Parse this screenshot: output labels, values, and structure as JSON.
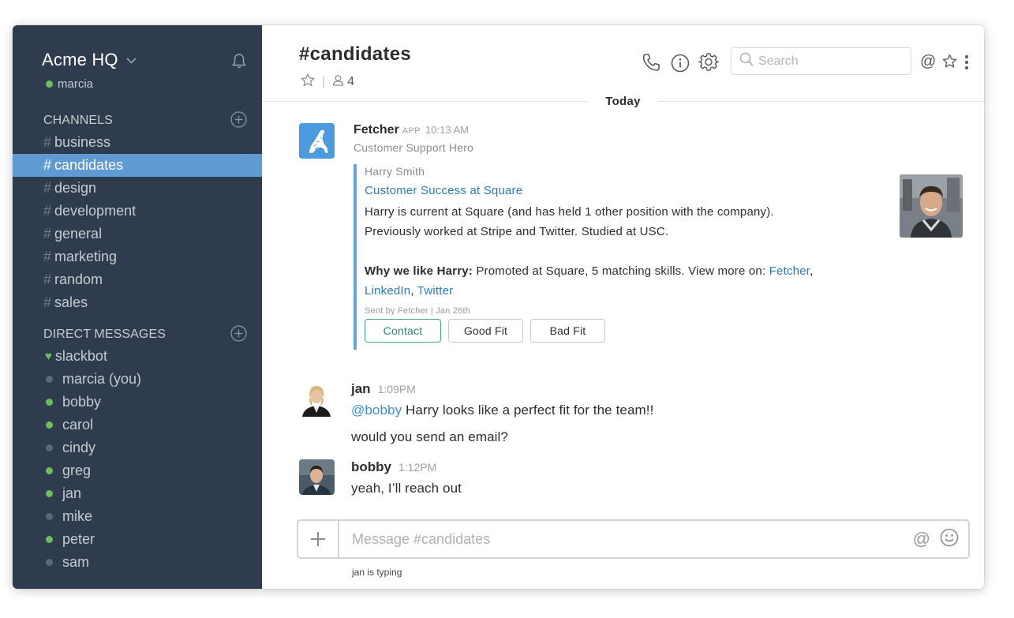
{
  "workspace": {
    "name": "Acme HQ",
    "current_user": "marcia"
  },
  "sidebar": {
    "channels_heading": "CHANNELS",
    "channels": [
      {
        "label": "business",
        "active": false
      },
      {
        "label": "candidates",
        "active": true
      },
      {
        "label": "design",
        "active": false
      },
      {
        "label": "development",
        "active": false
      },
      {
        "label": "general",
        "active": false
      },
      {
        "label": "marketing",
        "active": false
      },
      {
        "label": "random",
        "active": false
      },
      {
        "label": "sales",
        "active": false
      }
    ],
    "dm_heading": "DIRECT MESSAGES",
    "dms": [
      {
        "label": "slackbot",
        "status": "bot"
      },
      {
        "label": "marcia (you)",
        "status": "away"
      },
      {
        "label": "bobby",
        "status": "online"
      },
      {
        "label": "carol",
        "status": "online"
      },
      {
        "label": "cindy",
        "status": "away"
      },
      {
        "label": "greg",
        "status": "online"
      },
      {
        "label": "jan",
        "status": "online"
      },
      {
        "label": "mike",
        "status": "away"
      },
      {
        "label": "peter",
        "status": "online"
      },
      {
        "label": "sam",
        "status": "away"
      }
    ]
  },
  "header": {
    "channel_name": "#candidates",
    "member_count": "4",
    "search_placeholder": "Search"
  },
  "divider": {
    "label": "Today"
  },
  "messages": {
    "fetcher": {
      "author": "Fetcher",
      "badge": "APP",
      "time": "10:13 AM",
      "subtitle": "Customer Support Hero",
      "attachment": {
        "pretext": "Harry Smith",
        "title": "Customer Success at Square",
        "line1": "Harry is current at Square (and has held 1 other position with the company).",
        "line2": "Previously worked at Stripe and Twitter. Studied at USC.",
        "why_label": "Why we like Harry:",
        "why_text": " Promoted at Square, 5 matching skills. View more on: ",
        "link_fetcher": "Fetcher",
        "link_linkedin": "LinkedIn",
        "link_twitter": "Twitter",
        "comma": ",",
        "footer": "Sent by Fetcher | Jan 26th",
        "actions": [
          "Contact",
          "Good Fit",
          "Bad Fit"
        ]
      }
    },
    "jan": {
      "author": "jan",
      "time": "1:09PM",
      "mention": "@bobby",
      "text1": " Harry looks like a perfect fit for the team!!",
      "text2": "would you send an email?"
    },
    "bobby": {
      "author": "bobby",
      "time": "1:12PM",
      "text": "yeah, I’ll reach out"
    }
  },
  "composer": {
    "placeholder": "Message #candidates",
    "typing_indicator": "jan is typing"
  },
  "colors": {
    "sidebar_bg": "#2e3c4d",
    "active_channel": "#5f9ad2",
    "online": "#6dbd5d",
    "link": "#2b7bb9",
    "attachment_bar": "#5ca4e5",
    "primary_button": "#3aa888"
  }
}
